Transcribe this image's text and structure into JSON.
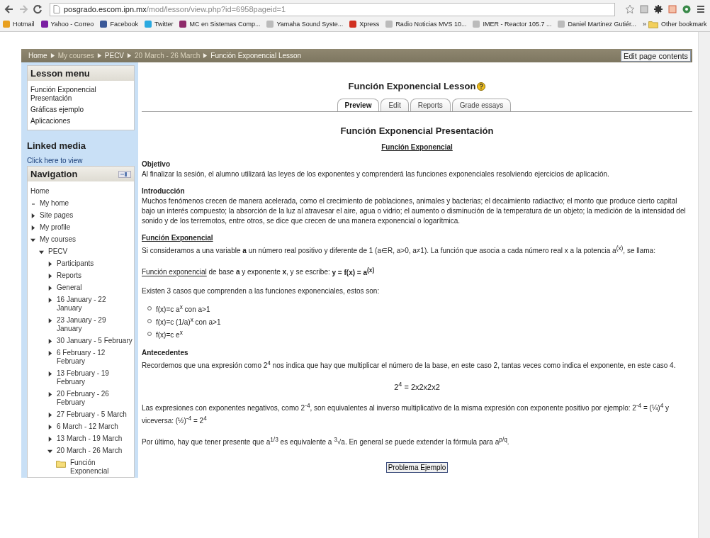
{
  "browser": {
    "url_host": "posgrado.escom.ipn.mx",
    "url_path": "/mod/lesson/view.php?id=6958pageid=1",
    "bookmarks": [
      {
        "label": "Hotmail",
        "color": "#e8a020"
      },
      {
        "label": "Yahoo - Correo",
        "color": "#7b1fa2"
      },
      {
        "label": "Facebook",
        "color": "#3b5998"
      },
      {
        "label": "Twitter",
        "color": "#2aa9e0"
      },
      {
        "label": "MC en Sistemas Comp...",
        "color": "#8e2a6a"
      },
      {
        "label": "Yamaha Sound Syste...",
        "color": "#bbbbbb"
      },
      {
        "label": "Xpress",
        "color": "#d03020"
      },
      {
        "label": "Radio Noticias MVS 10...",
        "color": "#bbbbbb"
      },
      {
        "label": "IMER - Reactor 105.7 ...",
        "color": "#bbbbbb"
      },
      {
        "label": "Daniel Martinez Gutiér...",
        "color": "#bbbbbb"
      }
    ],
    "overflow": "»",
    "other_bookmarks": "Other bookmark"
  },
  "breadcrumb": [
    {
      "label": "Home",
      "faded": false
    },
    {
      "label": "My courses",
      "faded": true
    },
    {
      "label": "PECV",
      "faded": false
    },
    {
      "label": "20 March - 26 March",
      "faded": true
    },
    {
      "label": "Función Exponencial Lesson",
      "faded": false
    }
  ],
  "edit_button": "Edit page contents",
  "lesson_menu": {
    "title": "Lesson menu",
    "items": [
      "Función Exponencial Presentación",
      "Gráficas ejemplo",
      "Aplicaciones"
    ]
  },
  "linked_media": {
    "title": "Linked media",
    "link": "Click here to view"
  },
  "navigation": {
    "title": "Navigation",
    "items": [
      {
        "kind": "plain",
        "label": "Home"
      },
      {
        "kind": "bullet",
        "label": "My home"
      },
      {
        "kind": "branch",
        "label": "Site pages",
        "expanded": false
      },
      {
        "kind": "branch",
        "label": "My profile",
        "expanded": false
      },
      {
        "kind": "branch",
        "label": "My courses",
        "expanded": true,
        "children": [
          {
            "kind": "branch",
            "label": "PECV",
            "expanded": true,
            "children": [
              {
                "kind": "branch",
                "label": "Participants",
                "expanded": false
              },
              {
                "kind": "branch",
                "label": "Reports",
                "expanded": false
              },
              {
                "kind": "branch",
                "label": "General",
                "expanded": false
              },
              {
                "kind": "branch",
                "label": "16 January - 22 January",
                "expanded": false
              },
              {
                "kind": "branch",
                "label": "23 January - 29 January",
                "expanded": false
              },
              {
                "kind": "branch",
                "label": "30 January - 5 February",
                "expanded": false
              },
              {
                "kind": "branch",
                "label": "6 February - 12 February",
                "expanded": false
              },
              {
                "kind": "branch",
                "label": "13 February - 19 February",
                "expanded": false
              },
              {
                "kind": "branch",
                "label": "20 February - 26 February",
                "expanded": false
              },
              {
                "kind": "branch",
                "label": "27 February - 5 March",
                "expanded": false
              },
              {
                "kind": "branch",
                "label": "6 March - 12 March",
                "expanded": false
              },
              {
                "kind": "branch",
                "label": "13 March - 19 March",
                "expanded": false
              },
              {
                "kind": "branch",
                "label": "20 March - 26 March",
                "expanded": true,
                "children": [
                  {
                    "kind": "folder",
                    "label": "Función Exponencial"
                  }
                ]
              }
            ]
          }
        ]
      }
    ]
  },
  "lesson": {
    "title": "Función Exponencial Lesson",
    "tabs": [
      {
        "label": "Preview",
        "selected": true
      },
      {
        "label": "Edit",
        "selected": false
      },
      {
        "label": "Reports",
        "selected": false
      },
      {
        "label": "Grade essays",
        "selected": false
      }
    ]
  },
  "page": {
    "title": "Función Exponencial Presentación",
    "subtitle": "Función Exponencial",
    "blocks": [
      {
        "kind": "heading",
        "text": "Objetivo",
        "underlined": false
      },
      {
        "kind": "para",
        "text": "Al finalizar la sesión, el alumno utilizará las leyes de los exponentes y comprenderá las funciones exponenciales resolviendo ejercicios de aplicación."
      },
      {
        "kind": "heading",
        "text": "Introducción",
        "underlined": false
      },
      {
        "kind": "para",
        "text": "Muchos fenómenos crecen de manera acelerada, como el crecimiento de poblaciones, animales y bacterias; el decaimiento radiactivo; el monto que produce cierto capital bajo un interés compuesto; la absorción de la luz al atravesar el aire, agua o vidrio; el aumento o disminución de la  temperatura de un objeto; la medición de la intensidad del sonido y de los terremotos, entre otros, se dice que crecen de una manera exponencial o logarítmica."
      },
      {
        "kind": "heading",
        "text": "Función Exponencial",
        "underlined": true
      },
      {
        "kind": "para",
        "text": "Si consideramos a una variable **a** un número real positivo y diferente de 1 (a∈R, a>0, a≠1). La función que asocia a cada número real x a la potencia a$^{(x)}$, se llama:"
      },
      {
        "kind": "linkpara",
        "link": "Función exponencial",
        "text": " de base **a** y exponente **x**, y se escribe: **y = f(x) = a$^{(x)}$**"
      },
      {
        "kind": "para",
        "text": "Existen 3 casos que comprenden a las funciones exponenciales, estos son:"
      },
      {
        "kind": "list",
        "items": [
          "f(x)=c a$^{x}$ con a>1",
          "f(x)=c (1/a)$^{x}$ con a>1",
          "f(x)=c e$^{x}$"
        ]
      },
      {
        "kind": "heading",
        "text": "Antecedentes",
        "underlined": false
      },
      {
        "kind": "para",
        "text": "Recordemos que una expresión como 2$^{4}$ nos indica que hay que multiplicar el número de la base, en este caso 2, tantas veces como indica el exponente, en este caso 4."
      },
      {
        "kind": "equation",
        "text": "2$^{4}$ = 2x2x2x2"
      },
      {
        "kind": "para",
        "text": "Las expresiones con exponentes negativos, como 2$^{-4}$, son equivalentes al inverso multiplicativo de la misma expresión con exponente positivo por ejemplo: 2$^{-4}$ = (¼)$^{4}$ y viceversa: (½)$^{-4}$ = 2$^{4}$"
      },
      {
        "kind": "para",
        "text": "Por último, hay que tener presente que a$^{1/3}$  es equivalente a $^{3}$√a. En general se puede extender la fórmula para a$^{p/q}$."
      }
    ],
    "button": "Problema Ejemplo"
  }
}
